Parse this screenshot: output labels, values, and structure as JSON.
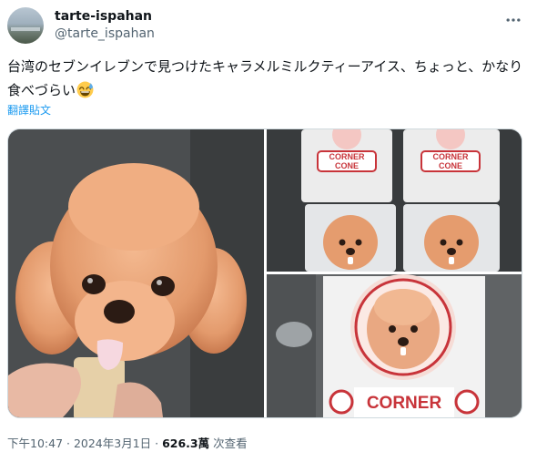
{
  "user": {
    "display_name": "tarte-ispahan",
    "handle": "@tarte_ispahan"
  },
  "tweet": {
    "text": "台湾のセブンイレブンで見つけたキャラメルミルクティーアイス、ちょっと、かなり食べづらい",
    "emoji": "grinning-face-with-sweat",
    "translate_label": "翻譯貼文"
  },
  "media": {
    "box_brand_line1": "CORNER",
    "box_brand_line2": "CONE",
    "large_box_brand": "CORNER"
  },
  "footer": {
    "time": "下午10:47",
    "sep1": " · ",
    "date": "2024年3月1日",
    "sep2": " · ",
    "views_count": "626.3萬",
    "views_label": " 次查看"
  },
  "colors": {
    "link": "#1d9bf0",
    "muted": "#536471",
    "text": "#0f1419",
    "brand_red": "#c8343a",
    "poodle": "#e9a47a"
  }
}
